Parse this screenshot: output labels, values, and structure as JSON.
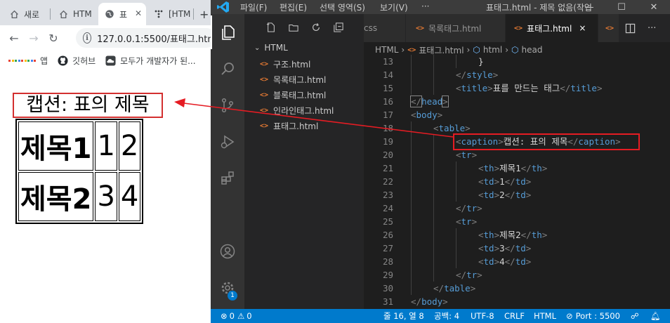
{
  "browser": {
    "tabs": [
      {
        "label": "새로"
      },
      {
        "label": "HTM"
      },
      {
        "label": "표"
      },
      {
        "label": "[HTM"
      }
    ],
    "new_tab": "+",
    "url": "127.0.0.1:5500/표태그.htm",
    "bookmarks": [
      {
        "label": "앱"
      },
      {
        "label": "깃허브"
      },
      {
        "label": "모두가 개발자가 된..."
      }
    ],
    "page": {
      "caption": "캡션: 표의 제목",
      "rows": [
        {
          "th": "제목1",
          "td": [
            "1",
            "2"
          ]
        },
        {
          "th": "제목2",
          "td": [
            "3",
            "4"
          ]
        }
      ]
    }
  },
  "vscode": {
    "menu": [
      "파일(F)",
      "편집(E)",
      "선택 영역(S)",
      "보기(V)",
      "···"
    ],
    "window_title": "표태그.html - 제목 없음(작업",
    "sidebar": {
      "root": "HTML",
      "files": [
        "구조.html",
        "목록태그.html",
        "블록태그.html",
        "인라인태그.html",
        "표태그.html"
      ]
    },
    "tabs": [
      {
        "label": "css"
      },
      {
        "label": "목록태그.html"
      },
      {
        "label": "표태그.html",
        "close": "×"
      }
    ],
    "breadcrumbs": [
      "HTML",
      "표태그.html",
      "html",
      "head"
    ],
    "status": {
      "errors": "0",
      "warnings": "0",
      "cursor": "줄 16, 열 8",
      "spaces": "공백: 4",
      "encoding": "UTF-8",
      "eol": "CRLF",
      "language": "HTML",
      "port": "Port : 5500"
    },
    "accounts_badge": "1",
    "code": [
      {
        "n": "13",
        "indent": 3,
        "parts": [
          [
            "tx",
            "}"
          ]
        ]
      },
      {
        "n": "14",
        "indent": 2,
        "parts": [
          [
            "t",
            "</"
          ],
          [
            "tg",
            "style"
          ],
          [
            "t",
            ">"
          ]
        ]
      },
      {
        "n": "15",
        "indent": 2,
        "parts": [
          [
            "t",
            "<"
          ],
          [
            "tg",
            "title"
          ],
          [
            "t",
            ">"
          ],
          [
            "tx",
            "표를 만드는 태그"
          ],
          [
            "t",
            "</"
          ],
          [
            "tg",
            "title"
          ],
          [
            "t",
            ">"
          ]
        ]
      },
      {
        "n": "16",
        "indent": 0,
        "parts": [
          [
            "t",
            "</"
          ],
          [
            "tg",
            "head"
          ],
          [
            "t",
            ">"
          ]
        ]
      },
      {
        "n": "17",
        "indent": 0,
        "parts": [
          [
            "t",
            "<"
          ],
          [
            "tg",
            "body"
          ],
          [
            "t",
            ">"
          ]
        ]
      },
      {
        "n": "18",
        "indent": 1,
        "parts": [
          [
            "t",
            "<"
          ],
          [
            "tg",
            "table"
          ],
          [
            "t",
            ">"
          ]
        ]
      },
      {
        "n": "19",
        "indent": 2,
        "parts": [
          [
            "t",
            "<"
          ],
          [
            "tg",
            "caption"
          ],
          [
            "t",
            ">"
          ],
          [
            "tx",
            "캡션: 표의 제목"
          ],
          [
            "t",
            "</"
          ],
          [
            "tg",
            "caption"
          ],
          [
            "t",
            ">"
          ]
        ]
      },
      {
        "n": "20",
        "indent": 2,
        "parts": [
          [
            "t",
            "<"
          ],
          [
            "tg",
            "tr"
          ],
          [
            "t",
            ">"
          ]
        ]
      },
      {
        "n": "21",
        "indent": 3,
        "parts": [
          [
            "t",
            "<"
          ],
          [
            "tg",
            "th"
          ],
          [
            "t",
            ">"
          ],
          [
            "tx",
            "제목1"
          ],
          [
            "t",
            "</"
          ],
          [
            "tg",
            "th"
          ],
          [
            "t",
            ">"
          ]
        ]
      },
      {
        "n": "22",
        "indent": 3,
        "parts": [
          [
            "t",
            "<"
          ],
          [
            "tg",
            "td"
          ],
          [
            "t",
            ">"
          ],
          [
            "tx",
            "1"
          ],
          [
            "t",
            "</"
          ],
          [
            "tg",
            "td"
          ],
          [
            "t",
            ">"
          ]
        ]
      },
      {
        "n": "23",
        "indent": 3,
        "parts": [
          [
            "t",
            "<"
          ],
          [
            "tg",
            "td"
          ],
          [
            "t",
            ">"
          ],
          [
            "tx",
            "2"
          ],
          [
            "t",
            "</"
          ],
          [
            "tg",
            "td"
          ],
          [
            "t",
            ">"
          ]
        ]
      },
      {
        "n": "24",
        "indent": 2,
        "parts": [
          [
            "t",
            "</"
          ],
          [
            "tg",
            "tr"
          ],
          [
            "t",
            ">"
          ]
        ]
      },
      {
        "n": "25",
        "indent": 2,
        "parts": [
          [
            "t",
            "<"
          ],
          [
            "tg",
            "tr"
          ],
          [
            "t",
            ">"
          ]
        ]
      },
      {
        "n": "26",
        "indent": 3,
        "parts": [
          [
            "t",
            "<"
          ],
          [
            "tg",
            "th"
          ],
          [
            "t",
            ">"
          ],
          [
            "tx",
            "제목2"
          ],
          [
            "t",
            "</"
          ],
          [
            "tg",
            "th"
          ],
          [
            "t",
            ">"
          ]
        ]
      },
      {
        "n": "27",
        "indent": 3,
        "parts": [
          [
            "t",
            "<"
          ],
          [
            "tg",
            "td"
          ],
          [
            "t",
            ">"
          ],
          [
            "tx",
            "3"
          ],
          [
            "t",
            "</"
          ],
          [
            "tg",
            "td"
          ],
          [
            "t",
            ">"
          ]
        ]
      },
      {
        "n": "28",
        "indent": 3,
        "parts": [
          [
            "t",
            "<"
          ],
          [
            "tg",
            "td"
          ],
          [
            "t",
            ">"
          ],
          [
            "tx",
            "4"
          ],
          [
            "t",
            "</"
          ],
          [
            "tg",
            "td"
          ],
          [
            "t",
            ">"
          ]
        ]
      },
      {
        "n": "29",
        "indent": 2,
        "parts": [
          [
            "t",
            "</"
          ],
          [
            "tg",
            "tr"
          ],
          [
            "t",
            ">"
          ]
        ]
      },
      {
        "n": "30",
        "indent": 1,
        "parts": [
          [
            "t",
            "</"
          ],
          [
            "tg",
            "table"
          ],
          [
            "t",
            ">"
          ]
        ]
      },
      {
        "n": "31",
        "indent": 0,
        "parts": [
          [
            "t",
            "</"
          ],
          [
            "tg",
            "body"
          ],
          [
            "t",
            ">"
          ]
        ]
      }
    ]
  },
  "colors": {
    "annotation_red": "#d32f2f",
    "vscode_blue": "#007acc",
    "tag_blue": "#569cd6"
  }
}
